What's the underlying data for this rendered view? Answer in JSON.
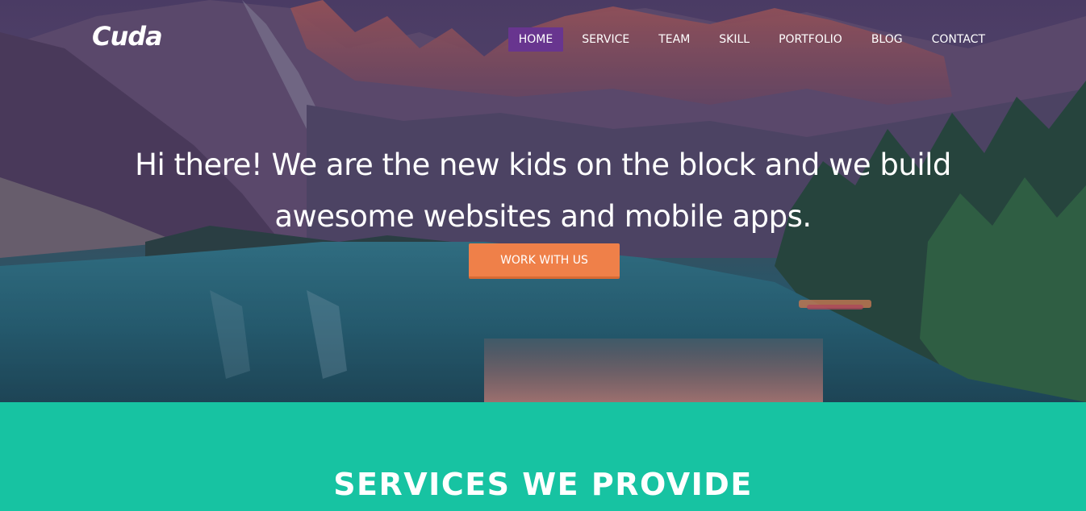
{
  "brand": {
    "logo_text": "Cuda"
  },
  "nav": {
    "items": [
      {
        "label": "HOME",
        "active": true
      },
      {
        "label": "SERVICE",
        "active": false
      },
      {
        "label": "TEAM",
        "active": false
      },
      {
        "label": "SKILL",
        "active": false
      },
      {
        "label": "PORTFOLIO",
        "active": false
      },
      {
        "label": "BLOG",
        "active": false
      },
      {
        "label": "CONTACT",
        "active": false
      }
    ]
  },
  "hero": {
    "headline_line1": "Hi there! We are the new kids on the block and we build",
    "headline_line2": "awesome websites and mobile apps.",
    "cta_label": "WORK WITH US"
  },
  "services": {
    "title": "SERVICES WE PROVIDE"
  },
  "colors": {
    "nav_active": "#68358f",
    "cta": "#ef8049",
    "services_bg": "#17c3a2"
  }
}
